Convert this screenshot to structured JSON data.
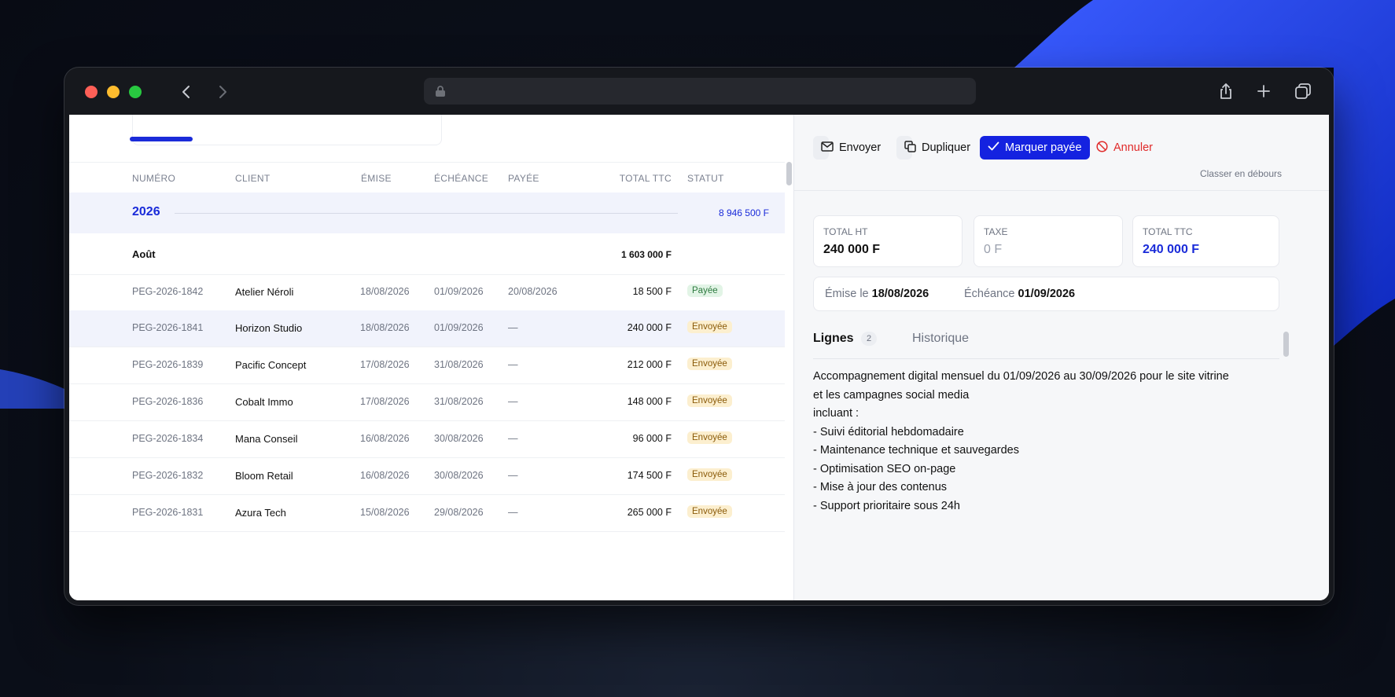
{
  "table": {
    "headers": {
      "numero": "NUMÉRO",
      "client": "CLIENT",
      "emise": "ÉMISE",
      "echeance": "ÉCHÉANCE",
      "payee": "PAYÉE",
      "total": "TOTAL TTC",
      "statut": "STATUT"
    },
    "year": {
      "label": "2026",
      "total": "8 946 500 F"
    },
    "month": {
      "label": "Août",
      "total": "1 603 000 F"
    },
    "rows": [
      {
        "numero": "PEG-2026-1842",
        "client": "Atelier Néroli",
        "emise": "18/08/2026",
        "echeance": "01/09/2026",
        "payee": "20/08/2026",
        "total": "18 500 F",
        "statut": "Payée"
      },
      {
        "numero": "PEG-2026-1841",
        "client": "Horizon Studio",
        "emise": "18/08/2026",
        "echeance": "01/09/2026",
        "payee": "—",
        "total": "240 000 F",
        "statut": "Envoyée"
      },
      {
        "numero": "PEG-2026-1839",
        "client": "Pacific Concept",
        "emise": "17/08/2026",
        "echeance": "31/08/2026",
        "payee": "—",
        "total": "212 000 F",
        "statut": "Envoyée"
      },
      {
        "numero": "PEG-2026-1836",
        "client": "Cobalt Immo",
        "emise": "17/08/2026",
        "echeance": "31/08/2026",
        "payee": "—",
        "total": "148 000 F",
        "statut": "Envoyée"
      },
      {
        "numero": "PEG-2026-1834",
        "client": "Mana Conseil",
        "emise": "16/08/2026",
        "echeance": "30/08/2026",
        "payee": "—",
        "total": "96 000 F",
        "statut": "Envoyée"
      },
      {
        "numero": "PEG-2026-1832",
        "client": "Bloom Retail",
        "emise": "16/08/2026",
        "echeance": "30/08/2026",
        "payee": "—",
        "total": "174 500 F",
        "statut": "Envoyée"
      },
      {
        "numero": "PEG-2026-1831",
        "client": "Azura Tech",
        "emise": "15/08/2026",
        "echeance": "29/08/2026",
        "payee": "—",
        "total": "265 000 F",
        "statut": "Envoyée"
      }
    ]
  },
  "detail": {
    "actions": {
      "send": "Envoyer",
      "duplicate": "Dupliquer",
      "mark_paid": "Marquer payée",
      "cancel": "Annuler",
      "classify": "Classer en débours"
    },
    "totals": {
      "ht_label": "TOTAL HT",
      "ht_value": "240 000 F",
      "tax_label": "TAXE",
      "tax_value": "0 F",
      "ttc_label": "TOTAL TTC",
      "ttc_value": "240 000 F"
    },
    "dates": {
      "issued_label": "Émise le",
      "issued_value": "18/08/2026",
      "due_label": "Échéance",
      "due_value": "01/09/2026"
    },
    "tabs": {
      "lines": "Lignes",
      "lines_count": "2",
      "history": "Historique"
    },
    "description": [
      "Accompagnement digital mensuel du 01/09/2026 au 30/09/2026 pour le site vitrine",
      "et les campagnes social media",
      "incluant :",
      "- Suivi éditorial hebdomadaire",
      "- Maintenance technique et sauvegardes",
      "- Optimisation SEO on-page",
      "- Mise à jour des contenus",
      "- Support prioritaire sous 24h"
    ]
  },
  "colors": {
    "accent": "#1422e0",
    "danger": "#e02a2a",
    "paid_bg": "#e2f4e6",
    "sent_bg": "#fcefcf"
  },
  "icons": [
    "back-chevron-icon",
    "forward-chevron-icon",
    "lock-icon",
    "share-icon",
    "new-tab-icon",
    "tabs-overview-icon",
    "mail-icon",
    "copy-icon",
    "check-icon",
    "ban-icon"
  ]
}
